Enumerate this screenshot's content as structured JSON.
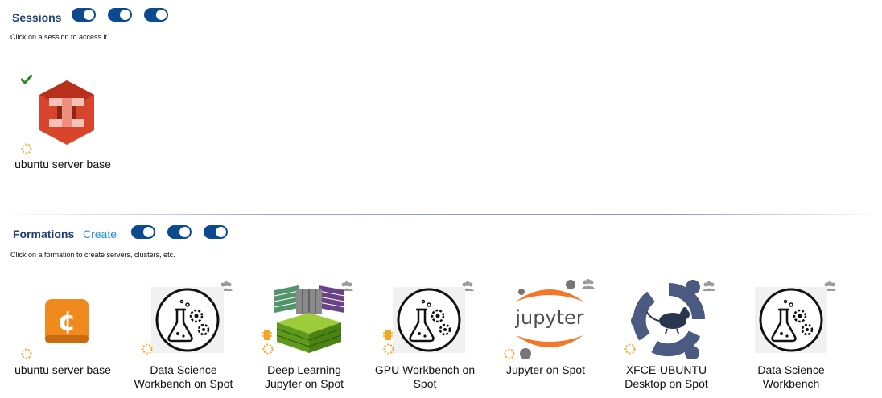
{
  "sessions": {
    "title": "Sessions",
    "hint": "Click on a session to access it",
    "items": [
      {
        "label": "ubuntu server base",
        "icon": "aws-ec2-icon",
        "status": "running-check",
        "loading": true
      }
    ]
  },
  "formations": {
    "title": "Formations",
    "create_label": "Create",
    "hint": "Click on a formation to create servers, clusters, etc.",
    "items": [
      {
        "label_line1": "ubuntu server base",
        "label_line2": "",
        "icon": "cent-sign-icon",
        "loading": true,
        "shared": false
      },
      {
        "label_line1": "Data Science",
        "label_line2": "Workbench on Spot",
        "icon": "science-workbench-icon",
        "loading": true,
        "shared": true
      },
      {
        "label_line1": "Deep Learning",
        "label_line2": "Jupyter on Spot",
        "icon": "deep-learning-cube-icon",
        "loading": true,
        "shared": true,
        "gpu": true
      },
      {
        "label_line1": "GPU Workbench on",
        "label_line2": "Spot",
        "icon": "science-workbench-icon",
        "loading": true,
        "shared": true,
        "gpu": true
      },
      {
        "label_line1": "Jupyter on Spot",
        "label_line2": "",
        "icon": "jupyter-logo-icon",
        "logo_text": "jupyter",
        "loading": true,
        "shared": true
      },
      {
        "label_line1": "XFCE-UBUNTU",
        "label_line2": "Desktop on Spot",
        "icon": "xfce-ubuntu-icon",
        "loading": true,
        "shared": true
      },
      {
        "label_line1": "Data Science",
        "label_line2": "Workbench",
        "icon": "science-workbench-icon",
        "loading": false,
        "shared": true
      }
    ]
  },
  "colors": {
    "accent": "#0b4a8f",
    "title": "#1f3e73",
    "link": "#1e8fd6",
    "spinner": "#f5a623",
    "check": "#2a8a2a",
    "aws": "#d9442c",
    "cent_bg": "#f18a1c",
    "jupyter_orange": "#f37726",
    "shared_icon": "#9a9a9a"
  }
}
